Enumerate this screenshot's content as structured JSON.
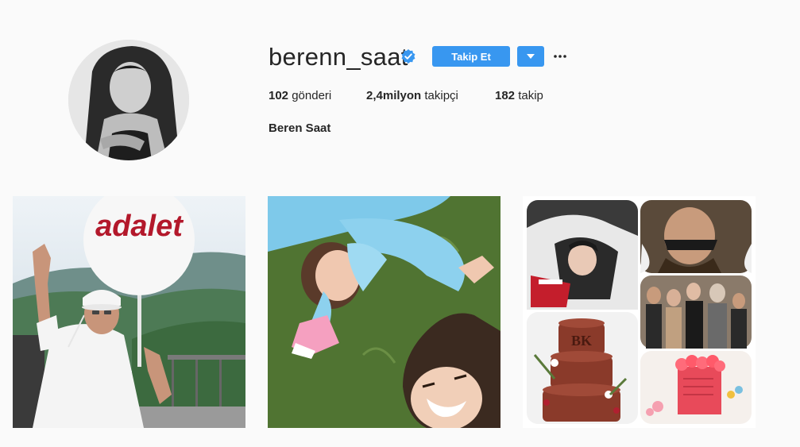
{
  "profile": {
    "username": "berenn_saat",
    "full_name": "Beren Saat",
    "verified": true,
    "follow_label": "Takip Et",
    "stats": {
      "posts_value": "102",
      "posts_label": "gönderi",
      "followers_value": "2,4milyon",
      "followers_label": "takipçi",
      "following_value": "182",
      "following_label": "takip"
    }
  },
  "posts": [
    {
      "sign_text": "adalet"
    },
    {},
    {
      "cake_text": "BK"
    }
  ],
  "colors": {
    "accent": "#3897f0",
    "text": "#262626",
    "background": "#fafafa"
  },
  "icons": [
    "verified-badge-icon",
    "chevron-down-icon",
    "more-options-icon"
  ]
}
